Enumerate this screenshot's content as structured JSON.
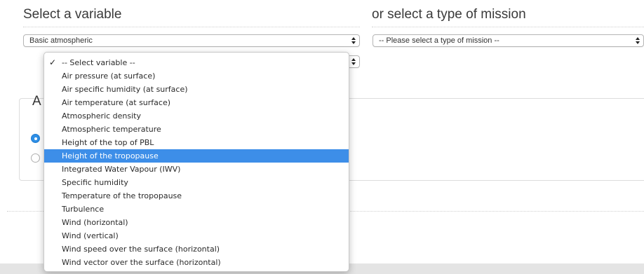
{
  "headings": {
    "left": "Select a variable",
    "right": "or select a type of mission"
  },
  "selects": {
    "category": {
      "value": "Basic atmospheric"
    },
    "mission": {
      "value": "-- Please select a type of mission --"
    }
  },
  "panel": {
    "heading": "A"
  },
  "dropdown": {
    "checked_index": 0,
    "highlighted_index": 7,
    "check_glyph": "✓",
    "options": [
      "-- Select variable --",
      "Air pressure (at surface)",
      "Air specific humidity (at surface)",
      "Air temperature (at surface)",
      "Atmospheric density",
      "Atmospheric temperature",
      "Height of the top of PBL",
      "Height of the tropopause",
      "Integrated Water Vapour (IWV)",
      "Specific humidity",
      "Temperature of the tropopause",
      "Turbulence",
      "Wind (horizontal)",
      "Wind (vertical)",
      "Wind speed over the surface (horizontal)",
      "Wind vector over the surface (horizontal)"
    ]
  },
  "colors": {
    "highlight": "#3d8ee8",
    "radio_selected": "#2e8fe6"
  }
}
